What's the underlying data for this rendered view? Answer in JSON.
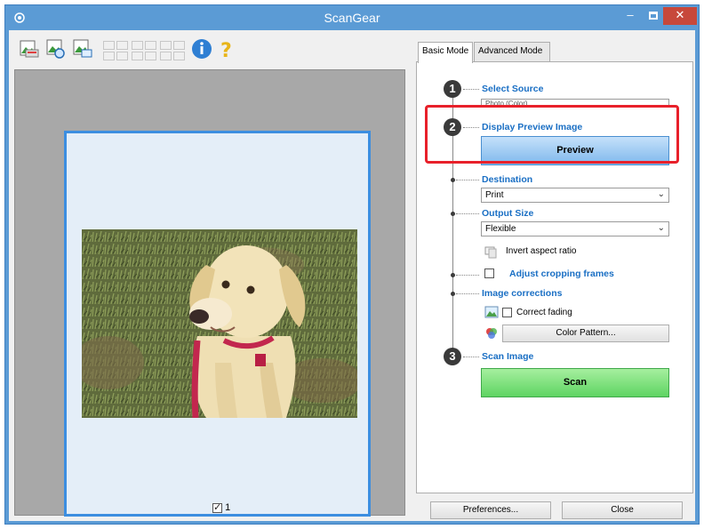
{
  "window": {
    "title": "ScanGear",
    "minimize_glyph": "–",
    "close_glyph": "✕"
  },
  "preview": {
    "page_number": "1",
    "page_checked": true
  },
  "tabs": [
    {
      "label": "Basic Mode",
      "active": true
    },
    {
      "label": "Advanced Mode",
      "active": false
    }
  ],
  "steps": {
    "step1": {
      "number": "1",
      "label": "Select Source",
      "value": "Photo (Color)"
    },
    "step2": {
      "number": "2",
      "label": "Display Preview Image",
      "button": "Preview"
    },
    "destination": {
      "label": "Destination",
      "value": "Print"
    },
    "output_size": {
      "label": "Output Size",
      "value": "Flexible"
    },
    "invert_aspect": "Invert aspect ratio",
    "adjust_cropping": "Adjust cropping frames",
    "image_corrections": {
      "label": "Image corrections",
      "correct_fading": "Correct fading",
      "color_pattern": "Color Pattern..."
    },
    "step3": {
      "number": "3",
      "label": "Scan Image",
      "button": "Scan"
    }
  },
  "footer": {
    "preferences": "Preferences...",
    "close": "Close"
  },
  "colors": {
    "titlebar": "#5b9bd5",
    "close_button": "#c7483b",
    "highlight": "#e8202a",
    "preview_button": "#7fb8ec",
    "scan_button": "#5ed462",
    "link_blue": "#1a6fc4"
  },
  "icons": [
    "app-icon",
    "scan-icon",
    "zoom-icon",
    "crop-icon",
    "info-icon",
    "help-icon"
  ]
}
